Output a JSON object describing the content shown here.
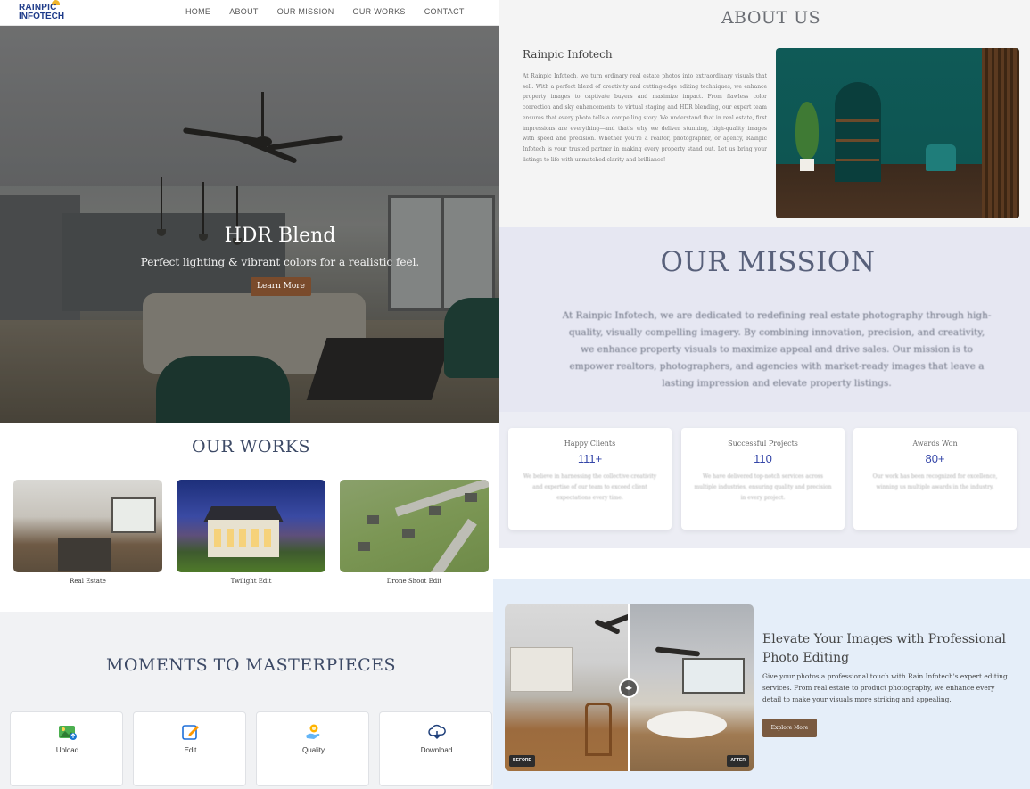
{
  "logo": {
    "line1": "RAINPIC",
    "line2": "INFOTECH"
  },
  "nav": {
    "items": [
      "HOME",
      "ABOUT",
      "OUR MISSION",
      "OUR WORKS",
      "CONTACT"
    ]
  },
  "hero": {
    "title": "HDR Blend",
    "subtitle": "Perfect lighting & vibrant colors for a realistic feel.",
    "button": "Learn More"
  },
  "works": {
    "title": "OUR WORKS",
    "items": [
      {
        "label": "Real Estate",
        "image": "kitchen-photo"
      },
      {
        "label": "Twilight Edit",
        "image": "twilight-house-photo"
      },
      {
        "label": "Drone Shoot Edit",
        "image": "aerial-neighborhood-photo"
      }
    ]
  },
  "moments": {
    "title": "MOMENTS TO MASTERPIECES",
    "cards": [
      {
        "label": "Upload",
        "icon": "upload-image-icon"
      },
      {
        "label": "Edit",
        "icon": "edit-icon"
      },
      {
        "label": "Quality",
        "icon": "quality-badge-icon"
      },
      {
        "label": "Download",
        "icon": "cloud-download-icon"
      }
    ]
  },
  "about": {
    "title": "ABOUT US",
    "company": "Rainpic Infotech",
    "body": "At Rainpic Infotech, we turn ordinary real estate photos into extraordinary visuals that sell. With a perfect blend of creativity and cutting-edge editing techniques, we enhance property images to captivate buyers and maximize impact. From flawless color correction and sky enhancements to virtual staging and HDR blending, our expert team ensures that every photo tells a compelling story. We understand that in real estate, first impressions are everything—and that's why we deliver stunning, high-quality images with speed and precision. Whether you're a realtor, photographer, or agency, Rainpic Infotech is your trusted partner in making every property stand out. Let us bring your listings to life with unmatched clarity and brilliance!"
  },
  "mission": {
    "title": "OUR MISSION",
    "body": "At Rainpic Infotech, we are dedicated to redefining real estate photography through high-quality, visually compelling imagery. By combining innovation, precision, and creativity, we enhance property visuals to maximize appeal and drive sales. Our mission is to empower realtors, photographers, and agencies with market-ready images that leave a lasting impression and elevate property listings."
  },
  "stats": [
    {
      "title": "Happy Clients",
      "value": "111+",
      "desc": "We believe in harnessing the collective creativity and expertise of our team to exceed client expectations every time."
    },
    {
      "title": "Successful Projects",
      "value": "110",
      "desc": "We have delivered top-notch services across multiple industries, ensuring quality and precision in every project."
    },
    {
      "title": "Awards Won",
      "value": "80+",
      "desc": "Our work has been recognized for excellence, winning us multiple awards in the industry."
    }
  ],
  "elevate": {
    "title": "Elevate Your Images with Professional Photo Editing",
    "body": "Give your photos a professional touch with Rain Infotech's expert editing services. From real estate to product photography, we enhance every detail to make your visuals more striking and appealing.",
    "button": "Explore More",
    "before_label": "BEFORE",
    "after_label": "AFTER"
  },
  "colors": {
    "brand": "#1f3c8a",
    "accent_button": "#7a4b2c",
    "stat_number": "#3446a8"
  }
}
